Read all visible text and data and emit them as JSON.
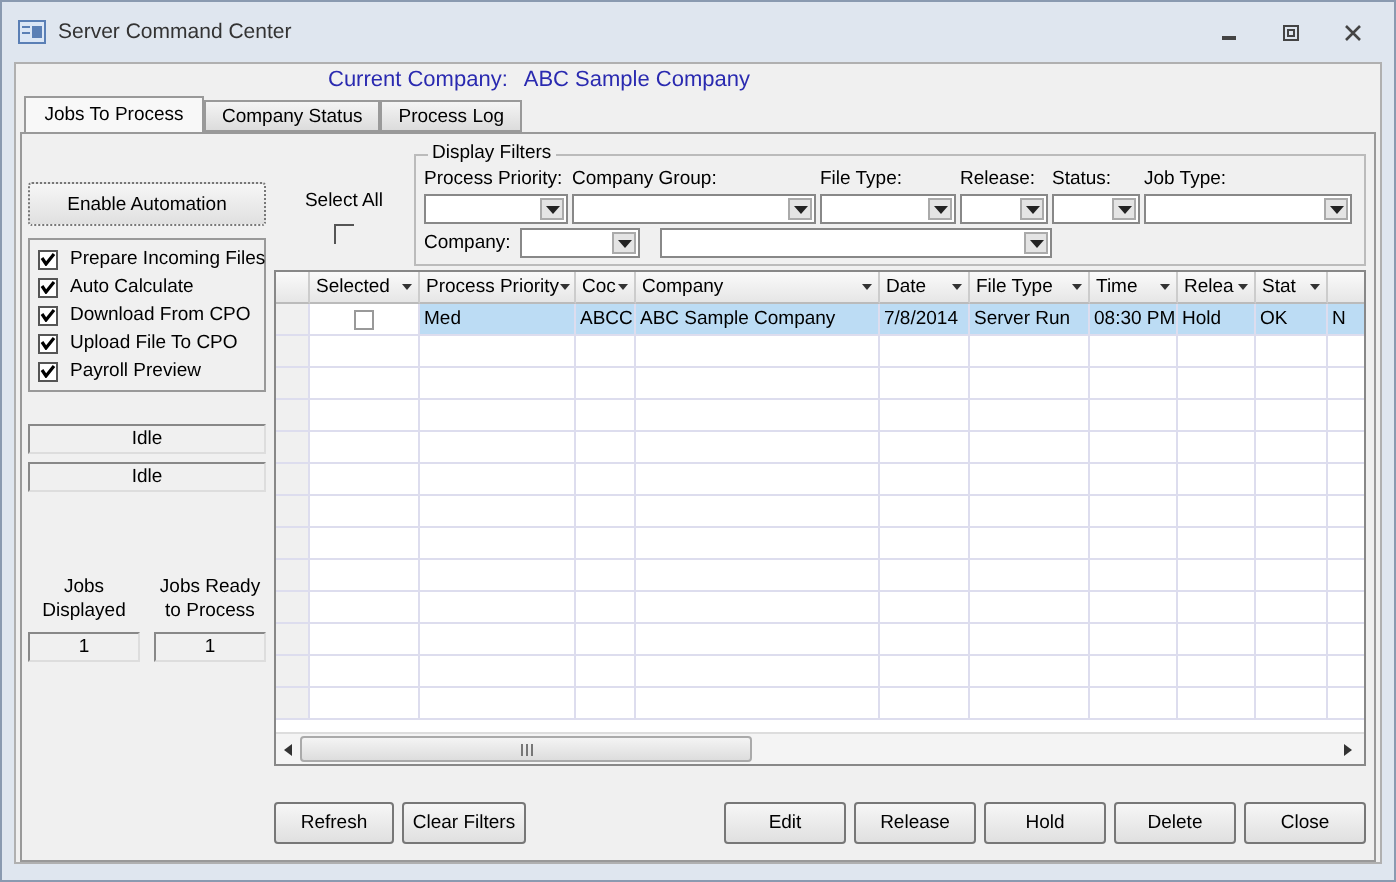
{
  "window": {
    "title": "Server Command Center"
  },
  "current_company": {
    "label": "Current Company:",
    "value": "ABC Sample Company"
  },
  "tabs": [
    {
      "label": "Jobs To Process",
      "selected": true
    },
    {
      "label": "Company Status",
      "selected": false
    },
    {
      "label": "Process Log",
      "selected": false
    }
  ],
  "automation_button": "Enable Automation",
  "options": [
    {
      "label": "Prepare Incoming Files",
      "checked": true
    },
    {
      "label": "Auto Calculate",
      "checked": true
    },
    {
      "label": "Download From CPO",
      "checked": true
    },
    {
      "label": "Upload File To CPO",
      "checked": true
    },
    {
      "label": "Payroll Preview",
      "checked": true
    }
  ],
  "status_fields": [
    "Idle",
    "Idle"
  ],
  "counters": [
    {
      "label": "Jobs Displayed",
      "value": "1"
    },
    {
      "label": "Jobs Ready to Process",
      "value": "1"
    }
  ],
  "select_all": {
    "label": "Select All",
    "checked": false
  },
  "filters": {
    "title": "Display Filters",
    "row1": [
      "Process Priority:",
      "Company Group:",
      "File Type:",
      "Release:",
      "Status:",
      "Job Type:"
    ],
    "company_label": "Company:"
  },
  "table": {
    "columns": [
      "Selected",
      "Process Priority",
      "Coc",
      "Company",
      "Date",
      "File Type",
      "Time",
      "Relea",
      "Stat"
    ],
    "rows": [
      {
        "selected": true,
        "checked": false,
        "cells": [
          "",
          "Med",
          "ABCC",
          "ABC Sample Company",
          "7/8/2014",
          "Server Run",
          "08:30 PM",
          "Hold",
          "OK",
          "N"
        ]
      }
    ]
  },
  "buttons_left": [
    "Refresh",
    "Clear Filters"
  ],
  "buttons_right": [
    "Edit",
    "Release",
    "Hold",
    "Delete",
    "Close"
  ]
}
